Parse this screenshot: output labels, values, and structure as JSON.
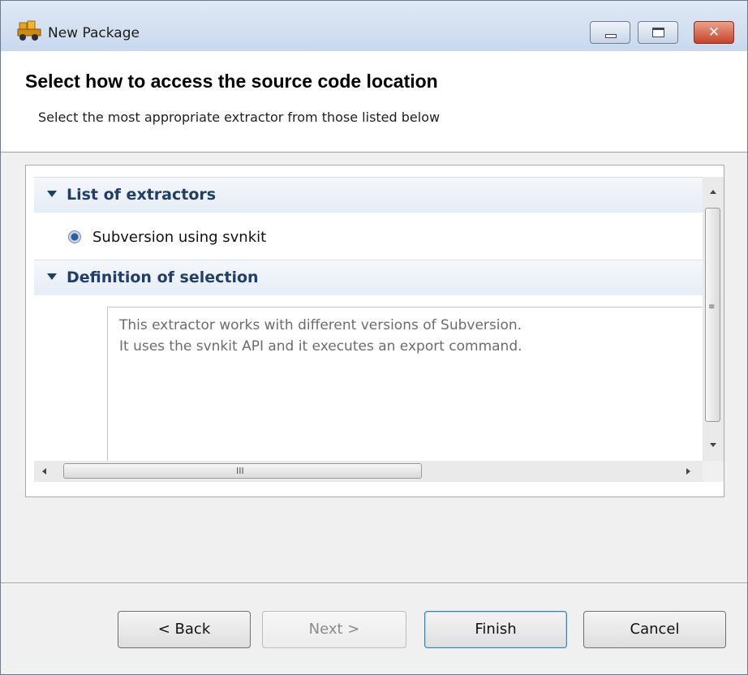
{
  "window": {
    "title": "New Package",
    "controls": {
      "minimize": "minimize-icon",
      "maximize": "maximize-icon",
      "close": "close-icon",
      "close_glyph": "✕"
    }
  },
  "header": {
    "heading": "Select how to access the source code location",
    "subheading": "Select the most appropriate extractor from those listed below"
  },
  "sections": {
    "extractors": {
      "title": "List of extractors",
      "options": [
        {
          "label": "Subversion using svnkit",
          "selected": true
        }
      ]
    },
    "definition": {
      "title": "Definition of selection",
      "lines": [
        "This extractor works with different versions of Subversion.",
        "It uses the svnkit API and it executes an export command."
      ]
    }
  },
  "scrollbars": {
    "vertical_grip": "≡",
    "horizontal_grip": "III"
  },
  "buttons": {
    "back": "< Back",
    "next": "Next >",
    "finish": "Finish",
    "cancel": "Cancel"
  },
  "colors": {
    "section_title": "#1f3f6b",
    "accent": "#3c7fb1",
    "close_button": "#c5432b"
  }
}
